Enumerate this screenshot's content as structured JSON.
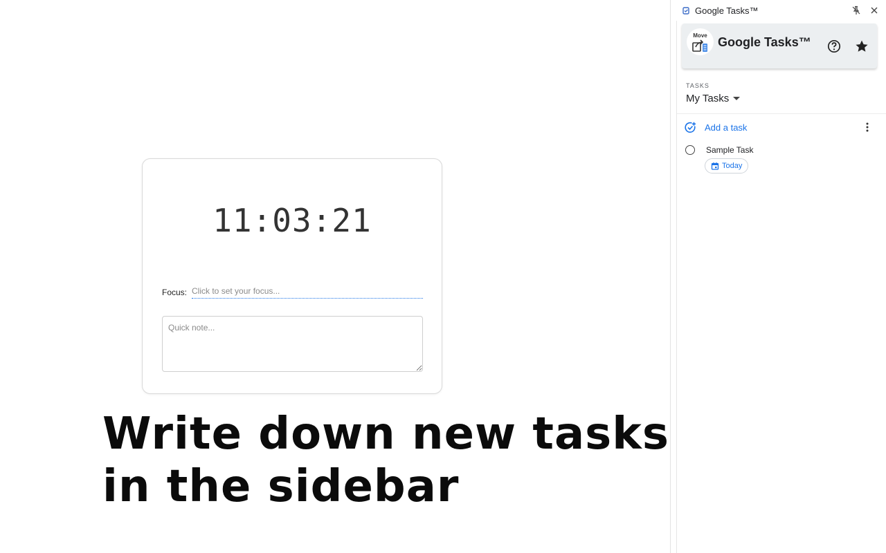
{
  "widget": {
    "clock": "11:03:21",
    "focus_label": "Focus:",
    "focus_placeholder": "Click to set your focus...",
    "note_placeholder": "Quick note..."
  },
  "headline": "Write down new tasks in the sidebar",
  "side_panel": {
    "window_title": "Google Tasks™",
    "extension_title": "Google Tasks™",
    "logo_text": "Move",
    "section_label": "TASKS",
    "list_name": "My Tasks",
    "add_task_label": "Add a task",
    "tasks": [
      {
        "title": "Sample Task",
        "due": "Today"
      }
    ],
    "icons": {
      "favicon": "tasks-favicon-icon",
      "unpin": "unpin-icon",
      "close": "close-icon",
      "help": "help-icon",
      "star": "star-icon",
      "add_task": "add-task-icon",
      "more": "more-vertical-icon",
      "calendar": "calendar-icon"
    },
    "accent_color": "#1a73e8"
  }
}
